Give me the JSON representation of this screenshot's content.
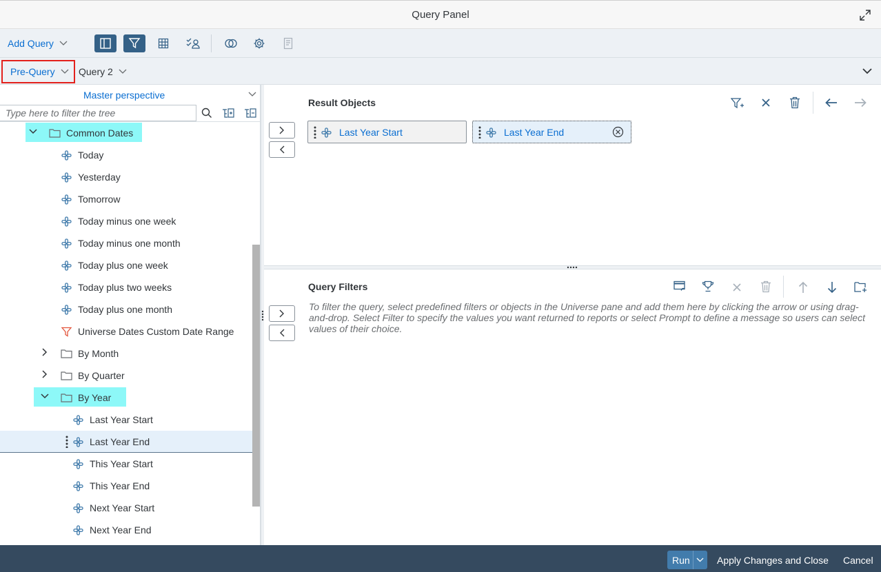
{
  "window": {
    "title": "Query Panel"
  },
  "toolbar": {
    "add_query_label": "Add Query"
  },
  "tabs": [
    {
      "label": "Pre-Query",
      "active": true
    },
    {
      "label": "Query 2",
      "active": false
    }
  ],
  "universe": {
    "perspective": "Master perspective",
    "filter_placeholder": "Type here to filter the tree",
    "tree": [
      {
        "label": "Common Dates",
        "type": "folder",
        "expanded": true,
        "highlight": true
      },
      {
        "label": "Today",
        "type": "object"
      },
      {
        "label": "Yesterday",
        "type": "object"
      },
      {
        "label": "Tomorrow",
        "type": "object"
      },
      {
        "label": "Today minus one week",
        "type": "object"
      },
      {
        "label": "Today minus one month",
        "type": "object"
      },
      {
        "label": "Today plus one week",
        "type": "object"
      },
      {
        "label": "Today plus two weeks",
        "type": "object"
      },
      {
        "label": "Today plus one month",
        "type": "object"
      },
      {
        "label": "Universe Dates Custom Date Range",
        "type": "filter"
      },
      {
        "label": "By Month",
        "type": "folder",
        "expanded": false
      },
      {
        "label": "By Quarter",
        "type": "folder",
        "expanded": false
      },
      {
        "label": "By Year",
        "type": "folder",
        "expanded": true,
        "highlight": true
      },
      {
        "label": "Last Year Start",
        "type": "object"
      },
      {
        "label": "Last Year End",
        "type": "object",
        "selected": true
      },
      {
        "label": "This Year Start",
        "type": "object"
      },
      {
        "label": "This Year End",
        "type": "object"
      },
      {
        "label": "Next Year Start",
        "type": "object"
      },
      {
        "label": "Next Year End",
        "type": "object"
      }
    ]
  },
  "result_objects": {
    "title": "Result Objects",
    "items": [
      {
        "label": "Last Year Start",
        "selected": false
      },
      {
        "label": "Last Year End",
        "selected": true
      }
    ]
  },
  "query_filters": {
    "title": "Query Filters",
    "message": "To filter the query, select predefined filters or objects in the Universe pane and add them here by clicking the arrow or using drag-and-drop. Select Filter to specify the values you want returned to reports or select Prompt to define a message so users can select values of their choice."
  },
  "footer": {
    "run_label": "Run",
    "apply_label": "Apply Changes and Close",
    "cancel_label": "Cancel"
  },
  "colors": {
    "accent": "#0a6ed1",
    "toolbar_active": "#346187",
    "footer_bg": "#354a5f",
    "tree_highlight": "#8df8f8",
    "focus_box": "#e3211c"
  }
}
